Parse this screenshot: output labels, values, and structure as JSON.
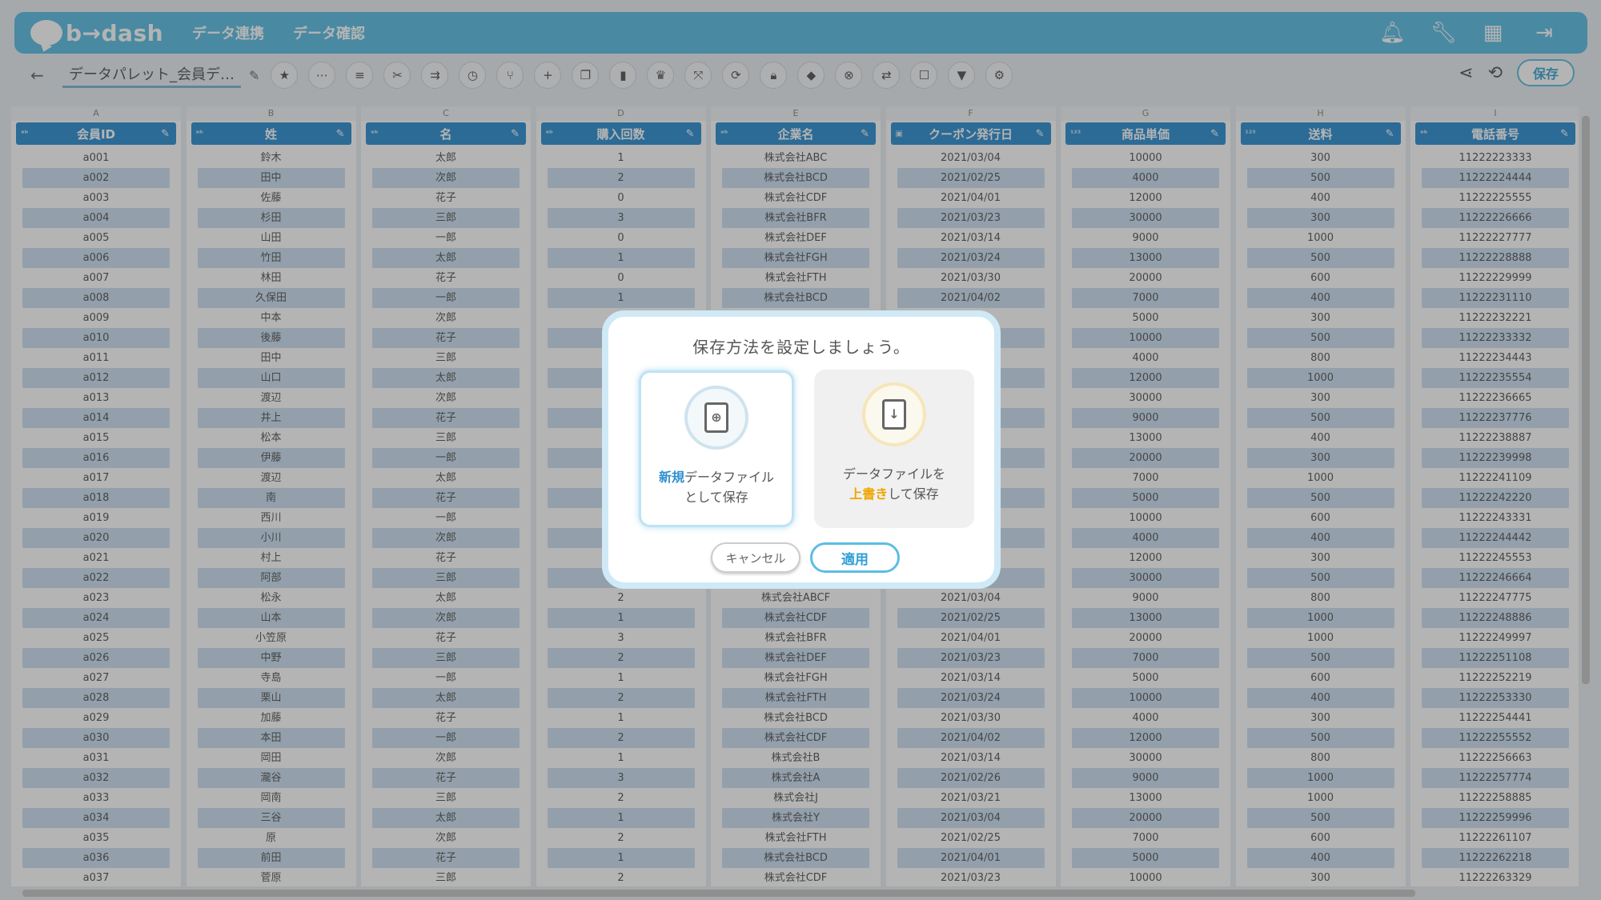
{
  "nav": {
    "logo": "b→dash",
    "links": [
      "データ連携",
      "データ確認"
    ],
    "icons": [
      "bell-icon",
      "wrench-icon",
      "apps-grid-icon",
      "logout-icon"
    ]
  },
  "toolbar": {
    "file_title": "データパレット_会員デ…",
    "save_label": "保存",
    "tool_icons": [
      "star-icon",
      "more-icon",
      "list-icon",
      "scissors-icon",
      "merge-icon",
      "timer-icon",
      "branch-icon",
      "plus-icon",
      "copy-icon",
      "trash-icon",
      "crown-icon",
      "expand-icon",
      "loop-icon",
      "lock-icon",
      "box-icon",
      "close-circle-icon",
      "replace-icon",
      "checkbox-icon",
      "filter-icon",
      "grid-settings-icon"
    ]
  },
  "table": {
    "columns": [
      {
        "letter": "A",
        "type": "ab",
        "name": "会員ID"
      },
      {
        "letter": "B",
        "type": "ab",
        "name": "姓"
      },
      {
        "letter": "C",
        "type": "ab",
        "name": "名"
      },
      {
        "letter": "D",
        "type": "ab",
        "name": "購入回数"
      },
      {
        "letter": "E",
        "type": "ab",
        "name": "企業名"
      },
      {
        "letter": "F",
        "type": "cal",
        "name": "クーポン発行日"
      },
      {
        "letter": "G",
        "type": "123",
        "name": "商品単価"
      },
      {
        "letter": "H",
        "type": "123",
        "name": "送料"
      },
      {
        "letter": "I",
        "type": "ab",
        "name": "電話番号"
      }
    ],
    "rows": [
      [
        "a001",
        "鈴木",
        "太郎",
        "1",
        "株式会社ABC",
        "2021/03/04",
        "10000",
        "300",
        "11222223333"
      ],
      [
        "a002",
        "田中",
        "次郎",
        "2",
        "株式会社BCD",
        "2021/02/25",
        "4000",
        "500",
        "11222224444"
      ],
      [
        "a003",
        "佐藤",
        "花子",
        "0",
        "株式会社CDF",
        "2021/04/01",
        "12000",
        "400",
        "11222225555"
      ],
      [
        "a004",
        "杉田",
        "三郎",
        "3",
        "株式会社BFR",
        "2021/03/23",
        "30000",
        "300",
        "11222226666"
      ],
      [
        "a005",
        "山田",
        "一郎",
        "0",
        "株式会社DEF",
        "2021/03/14",
        "9000",
        "1000",
        "11222227777"
      ],
      [
        "a006",
        "竹田",
        "太郎",
        "1",
        "株式会社FGH",
        "2021/03/24",
        "13000",
        "500",
        "11222228888"
      ],
      [
        "a007",
        "林田",
        "花子",
        "0",
        "株式会社FTH",
        "2021/03/30",
        "20000",
        "600",
        "11222229999"
      ],
      [
        "a008",
        "久保田",
        "一郎",
        "1",
        "株式会社BCD",
        "2021/04/02",
        "7000",
        "400",
        "11222231110"
      ],
      [
        "a009",
        "中本",
        "次郎",
        "",
        "",
        "",
        "5000",
        "300",
        "11222232221"
      ],
      [
        "a010",
        "後藤",
        "花子",
        "",
        "",
        "",
        "10000",
        "500",
        "11222233332"
      ],
      [
        "a011",
        "田中",
        "三郎",
        "",
        "",
        "",
        "4000",
        "800",
        "11222234443"
      ],
      [
        "a012",
        "山口",
        "太郎",
        "",
        "",
        "",
        "12000",
        "1000",
        "11222235554"
      ],
      [
        "a013",
        "渡辺",
        "次郎",
        "",
        "",
        "",
        "30000",
        "300",
        "11222236665"
      ],
      [
        "a014",
        "井上",
        "花子",
        "",
        "",
        "",
        "9000",
        "500",
        "11222237776"
      ],
      [
        "a015",
        "松本",
        "三郎",
        "",
        "",
        "",
        "13000",
        "400",
        "11222238887"
      ],
      [
        "a016",
        "伊藤",
        "一郎",
        "",
        "",
        "",
        "20000",
        "300",
        "11222239998"
      ],
      [
        "a017",
        "渡辺",
        "太郎",
        "",
        "",
        "",
        "7000",
        "1000",
        "11222241109"
      ],
      [
        "a018",
        "南",
        "花子",
        "",
        "",
        "",
        "5000",
        "500",
        "11222242220"
      ],
      [
        "a019",
        "西川",
        "一郎",
        "",
        "",
        "",
        "10000",
        "600",
        "11222243331"
      ],
      [
        "a020",
        "小川",
        "次郎",
        "",
        "",
        "",
        "4000",
        "400",
        "11222244442"
      ],
      [
        "a021",
        "村上",
        "花子",
        "",
        "",
        "",
        "12000",
        "300",
        "11222245553"
      ],
      [
        "a022",
        "阿部",
        "三郎",
        "",
        "",
        "",
        "30000",
        "500",
        "11222246664"
      ],
      [
        "a023",
        "松永",
        "太郎",
        "2",
        "株式会社ABCF",
        "2021/03/04",
        "9000",
        "800",
        "11222247775"
      ],
      [
        "a024",
        "山本",
        "次郎",
        "1",
        "株式会社CDF",
        "2021/02/25",
        "13000",
        "1000",
        "11222248886"
      ],
      [
        "a025",
        "小笠原",
        "花子",
        "3",
        "株式会社BFR",
        "2021/04/01",
        "20000",
        "1000",
        "11222249997"
      ],
      [
        "a026",
        "中野",
        "三郎",
        "2",
        "株式会社DEF",
        "2021/03/23",
        "7000",
        "500",
        "11222251108"
      ],
      [
        "a027",
        "寺島",
        "一郎",
        "1",
        "株式会社FGH",
        "2021/03/14",
        "5000",
        "600",
        "11222252219"
      ],
      [
        "a028",
        "栗山",
        "太郎",
        "2",
        "株式会社FTH",
        "2021/03/24",
        "10000",
        "400",
        "11222253330"
      ],
      [
        "a029",
        "加藤",
        "花子",
        "1",
        "株式会社BCD",
        "2021/03/30",
        "4000",
        "300",
        "11222254441"
      ],
      [
        "a030",
        "本田",
        "一郎",
        "2",
        "株式会社CDF",
        "2021/04/02",
        "12000",
        "500",
        "11222255552"
      ],
      [
        "a031",
        "岡田",
        "次郎",
        "1",
        "株式会社B",
        "2021/03/14",
        "30000",
        "800",
        "11222256663"
      ],
      [
        "a032",
        "瀧谷",
        "花子",
        "3",
        "株式会社A",
        "2021/02/26",
        "9000",
        "1000",
        "11222257774"
      ],
      [
        "a033",
        "岡南",
        "三郎",
        "2",
        "株式会社J",
        "2021/03/21",
        "13000",
        "1000",
        "11222258885"
      ],
      [
        "a034",
        "三谷",
        "太郎",
        "1",
        "株式会社Y",
        "2021/03/04",
        "20000",
        "500",
        "11222259996"
      ],
      [
        "a035",
        "原",
        "次郎",
        "2",
        "株式会社FTH",
        "2021/02/25",
        "7000",
        "600",
        "11222261107"
      ],
      [
        "a036",
        "前田",
        "花子",
        "1",
        "株式会社BCD",
        "2021/04/01",
        "5000",
        "400",
        "11222262218"
      ],
      [
        "a037",
        "菅原",
        "三郎",
        "2",
        "株式会社CDF",
        "2021/03/23",
        "10000",
        "300",
        "11222263329"
      ]
    ]
  },
  "modal": {
    "title": "保存方法を設定しましょう。",
    "option_new": {
      "highlight": "新規",
      "line1_rest": "データファイル",
      "line2": "として保存"
    },
    "option_overwrite": {
      "line1": "データファイルを",
      "highlight": "上書き",
      "line2_rest": "して保存"
    },
    "cancel_label": "キャンセル",
    "apply_label": "適用"
  }
}
